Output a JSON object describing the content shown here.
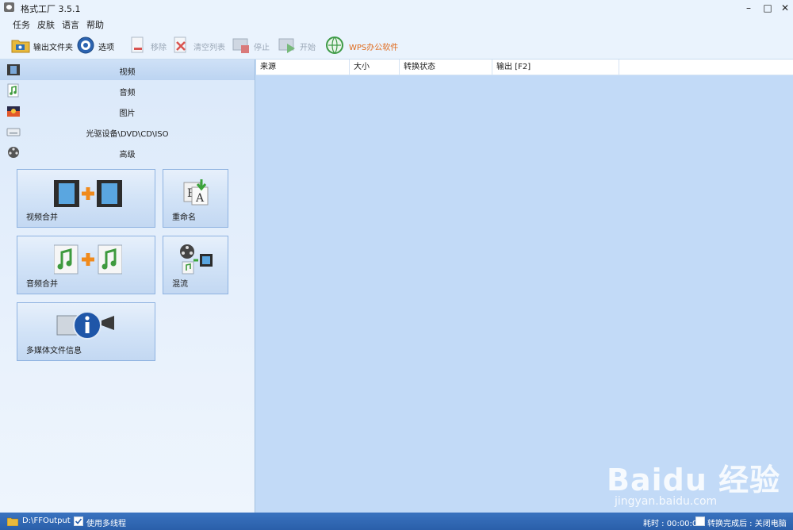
{
  "window": {
    "title": "格式工厂 3.5.1"
  },
  "menu": [
    "任务",
    "皮肤",
    "语言",
    "帮助"
  ],
  "toolbar": {
    "output_folder": "输出文件夹",
    "options": "选项",
    "remove": "移除",
    "clear_list": "清空列表",
    "stop": "停止",
    "start": "开始",
    "wps": "WPS办公软件"
  },
  "categories": [
    {
      "label": "视频",
      "icon": "film-icon"
    },
    {
      "label": "音频",
      "icon": "music-note-icon"
    },
    {
      "label": "图片",
      "icon": "picture-icon"
    },
    {
      "label": "光驱设备\\DVD\\CD\\ISO",
      "icon": "optical-drive-icon"
    },
    {
      "label": "高级",
      "icon": "film-reel-icon"
    }
  ],
  "tools": [
    {
      "label": "视频合并",
      "icon": "video-merge-icon"
    },
    {
      "label": "重命名",
      "icon": "rename-icon"
    },
    {
      "label": "音频合并",
      "icon": "audio-merge-icon"
    },
    {
      "label": "混流",
      "icon": "mux-icon"
    },
    {
      "label": "多媒体文件信息",
      "icon": "media-info-icon"
    }
  ],
  "table": {
    "columns": [
      "来源",
      "大小",
      "转换状态",
      "输出 [F2]"
    ]
  },
  "status": {
    "output_path": "D:\\FFOutput",
    "multithread": "使用多线程",
    "elapsed_label": "耗时 : 00:00:00",
    "after_done": "转换完成后 : 关闭电脑"
  },
  "watermark": {
    "brand": "Baidu 经验",
    "url": "jingyan.baidu.com"
  },
  "colors": {
    "accent": "#2a5faa",
    "panel": "#c2daf7",
    "wps": "#e06a1b"
  }
}
